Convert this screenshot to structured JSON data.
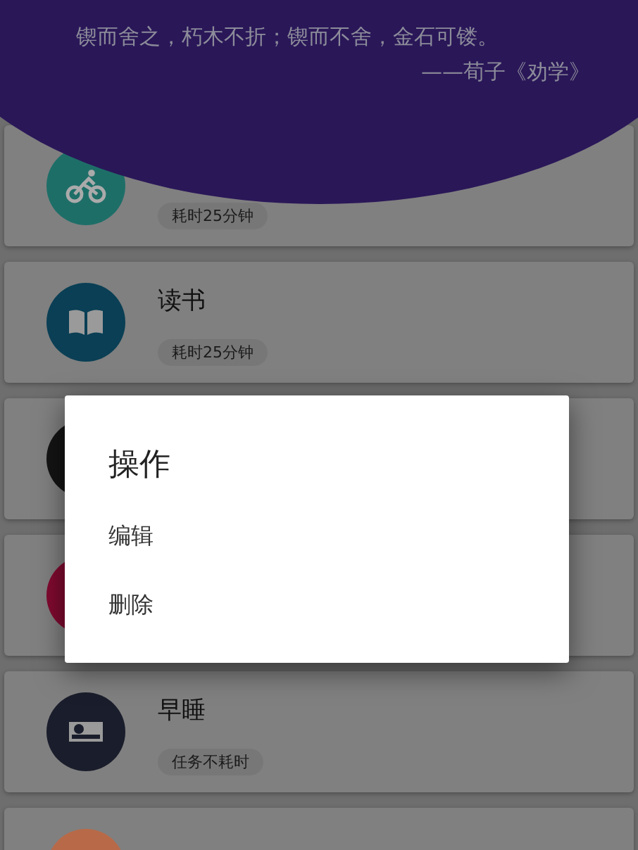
{
  "header": {
    "quote": "锲而舍之，朽木不折；锲而不舍，金石可镂。",
    "source": "——荀子《劝学》"
  },
  "tasks": [
    {
      "kind": "bike",
      "color": "#1e6e68",
      "badge": "耗时25分钟"
    },
    {
      "kind": "book",
      "color": "#0a3f55",
      "title": "读书",
      "badge": "耗时25分钟"
    },
    {
      "kind": "plain",
      "color": "#141414"
    },
    {
      "kind": "plain",
      "color": "#800a30"
    },
    {
      "kind": "bed",
      "color": "#1a1d2b",
      "title": "早睡",
      "badge": "任务不耗时"
    },
    {
      "kind": "plain",
      "color": "#b86a48"
    }
  ],
  "dialog": {
    "title": "操作",
    "options": [
      "编辑",
      "删除"
    ]
  }
}
